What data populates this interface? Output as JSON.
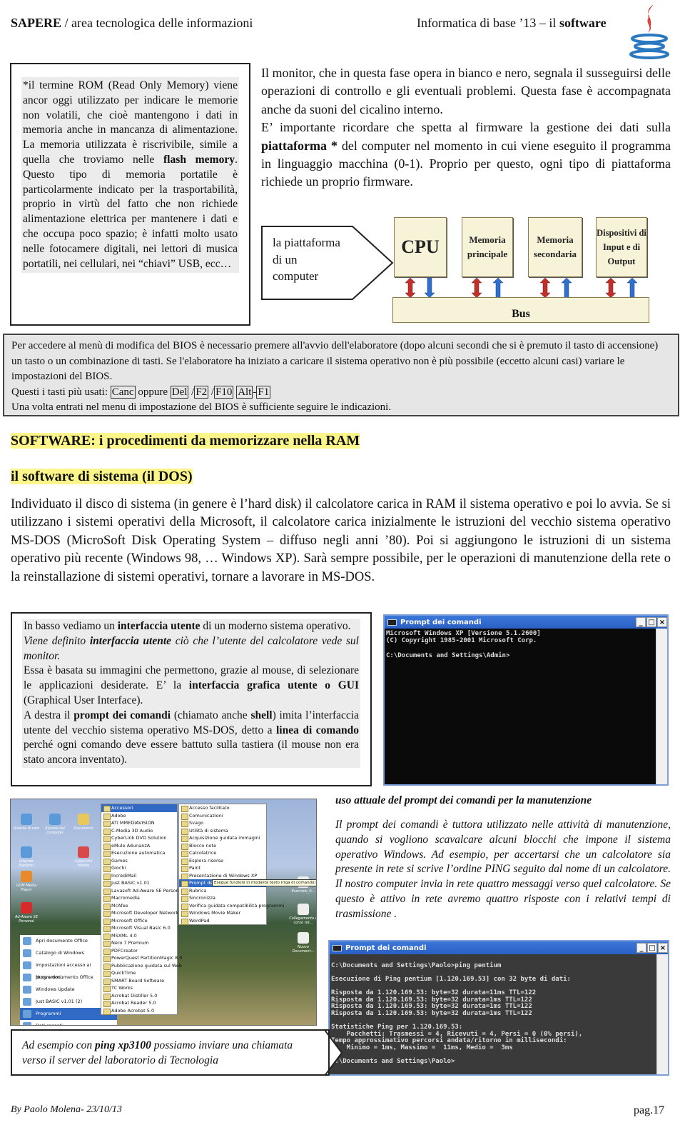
{
  "header": {
    "left_bold": "SAPERE",
    "left_rest": " / area tecnologica delle informazioni",
    "right_rest": "Informatica di base ’13 – il ",
    "right_bold": "software",
    "logo": "java-coffee-cup-logo"
  },
  "rom_box": {
    "p1": "*il termine ROM (Read Only Memory) viene ancor oggi utilizzato per indicare le memorie non volatili, che cioè mantengono i dati in memoria anche in mancanza di alimentazione. La memoria utilizzata è riscrivibile, simile a quella che troviamo nelle ",
    "p1_bold": "flash memory",
    "p2": ". Questo tipo di memoria portatile è particolarmente indicato per la trasportabilità, proprio in virtù del fatto che non richiede alimentazione elettrica per mantenere i dati e che occupa poco spazio; è infatti molto usato nelle fotocamere digitali, nei lettori di musica portatili, nei cellulari, nei “chiavi” USB, ecc…"
  },
  "right_text": {
    "p1": "Il monitor, che in questa fase opera in bianco e nero, segnala il susseguirsi delle operazioni di controllo e gli eventuali problemi. Questa fase è accompagnata anche da suoni del cicalino interno.",
    "p2a": "E’ importante ricordare che spetta al firmware la gestione dei dati sulla ",
    "p2b": "piattaforma *",
    "p2c": " del computer nel momento in cui viene eseguito il programma in linguaggio macchina (0-1). Proprio per questo, ogni tipo di piattaforma richiede un proprio firmware."
  },
  "callout": {
    "line1": "la piattaforma",
    "line2": "di un",
    "line3": "computer"
  },
  "diagram": {
    "modules": [
      "CPU",
      "Memoria principale",
      "Memoria secondaria",
      "Dispositivi di Input e di Output"
    ],
    "bus": "Bus",
    "colors": {
      "box": "#f7f3d8",
      "arrow_bidir": "#c0302a",
      "arrow_up": "#2f6fd0"
    }
  },
  "bios": {
    "line1": "Per accedere al menù di modifica del BIOS è necessario premere all'avvio dell'elaboratore (dopo alcuni secondi che si è premuto il tasto di accensione) un tasto o un combinazione di tasti. Se l'elaboratore ha iniziato a caricare il sistema operativo non è più possibile (eccetto alcuni casi) variare le impostazioni del BIOS.",
    "keys_intro": "Questi i tasti più usati: ",
    "keys": [
      "Canc",
      "Del",
      "F2",
      "F10",
      "Alt",
      "F1"
    ],
    "oppure": " oppure ",
    "last": "Una volta entrati nel menu di impostazione del BIOS è sufficiente seguire le indicazioni."
  },
  "software_title": "SOFTWARE: i procedimenti da memorizzare nella RAM",
  "dos_title": "il software di sistema (il DOS)",
  "dos_para": "Individuato il disco di sistema (in genere è l’hard disk) il calcolatore carica in RAM il sistema operativo e poi lo avvia. Se si utilizzano i sistemi operativi della Microsoft, il calcolatore carica inizialmente le istruzioni del vecchio sistema operativo MS-DOS (MicroSoft Disk Operating System – diffuso negli anni ’80). Poi si aggiungono le istruzioni di un sistema operativo più recente (Windows 98, … Windows XP). Sarà sempre possibile, per le operazioni di manutenzione della rete o la reinstallazione di sistemi operativi,  tornare a lavorare in MS-DOS.",
  "gui_box": {
    "a1": "In basso vediamo un ",
    "a2": "interfaccia utente",
    "a3": " di un moderno sistema operativo.",
    "b1": "Viene definito ",
    "b2": "interfaccia utente",
    "b3": " ciò che l’utente del calcolatore vede sul monitor.",
    "c1": "Essa è basata su immagini che permettono, grazie al mouse, di selezionare le applicazioni desiderate. E’ la ",
    "c2": "interfaccia grafica utente o GUI",
    "c3": " (Graphical User Interface).",
    "d1": "A destra il ",
    "d2": "prompt dei comandi",
    "d3": " (chiamato anche ",
    "d4": "shell",
    "d5": ") imita l’interfaccia utente del vecchio sistema operativo MS-DOS, detto a ",
    "d6": "linea di comando",
    "d7": " perché ogni comando deve essere battuto sulla tastiera (il mouse non era stato ancora inventato)."
  },
  "cmd1": {
    "title": "Prompt dei comandi",
    "body": "Microsoft Windows XP [Versione 5.1.2600]\n(C) Copyright 1985-2001 Microsoft Corp.\n\nC:\\Documents and Settings\\Admin>"
  },
  "cmd2": {
    "title": "Prompt dei comandi",
    "body": "\nC:\\Documents and Settings\\Paolo>ping pentium\n\nEsecuzione di Ping pentium [1.120.169.53] con 32 byte di dati:\n\nRisposta da 1.120.169.53: byte=32 durata=11ms TTL=122\nRisposta da 1.120.169.53: byte=32 durata=1ms TTL=122\nRisposta da 1.120.169.53: byte=32 durata=1ms TTL=122\nRisposta da 1.120.169.53: byte=32 durata=1ms TTL=122\n\nStatistiche Ping per 1.120.169.53:\n    Pacchetti: Trasmessi = 4, Ricevuti = 4, Persi = 0 (0% persi),\nTempo approssimativo percorsi andata/ritorno in millisecondi:\n    Minimo = 1ms, Massimo =  11ms, Medio =  3ms\n\nC:\\Documents and Settings\\Paolo>"
  },
  "desktop": {
    "icons": [
      "Risorse di rete",
      "Risorse del computer",
      "Documenti",
      "Internet Explorer",
      "CyberLink Mobile",
      "GOM Media Player",
      "Ad-Aware SE Personal",
      "Esercizio_0...",
      "Collegamento a corso ret...",
      "Nuovo Document..."
    ],
    "programs": [
      "Accessori",
      "Adobe",
      "ATI MMEDIAVISION",
      "C-Media 3D Audio",
      "CyberLink DVD Solution",
      "eMule AdunanzA",
      "Esecuzione automatica",
      "Games",
      "Giochi",
      "IncrediMail",
      "Just BASIC v1.01",
      "Lavasoft Ad-Aware SE Personal",
      "Macromedia",
      "McAfee",
      "Microsoft Developer Network",
      "Microsoft Office",
      "Microsoft Visual Basic 6.0",
      "MSXML 4.0",
      "Nero 7 Premium",
      "PDFCreator",
      "PowerQuest PartitionMagic 8.0",
      "Pubblicazione guidata sul Web",
      "QuickTime",
      "SMART Board Software",
      "TC Works",
      "Acrobat Distiller 5.0",
      "Acrobat Reader 5.0",
      "Adobe Acrobat 5.0"
    ],
    "accessori": [
      "Accesso facilitato",
      "Comunicazioni",
      "Svago",
      "Utilità di sistema",
      "Acquisizione guidata immagini",
      "Blocco note",
      "Calcolatrice",
      "Esplora risorse",
      "Paint",
      "Presentazione di Windows XP",
      "Prompt dei comandi",
      "Rubrica",
      "Sincronizza",
      "Verifica guidata compatibilità programmi",
      "Windows Movie Maker",
      "WordPad"
    ],
    "tooltip": "Esegue funzioni in modalità testo (riga di comando)",
    "start_left": [
      "Apri documento Office",
      "Catalogo di Windows",
      "Impostazioni accesso ai programmi",
      "Nuovo documento Office",
      "Windows Update",
      "Just BASIC v1.01 (2)",
      "Programmi",
      "Dati recenti"
    ]
  },
  "right_section": {
    "title": "uso attuale del prompt dei comandi per la manutenzione",
    "body": "Il prompt dei comandi è tuttora utilizzato nelle attività di manutenzione, quando si vogliono scavalcare alcuni blocchi che impone il sistema operativo Windows. Ad esempio, per accertarsi che un calcolatore sia presente in rete si scrive l’ordine PING seguito dal nome di un calcolatore. Il nostro computer invia in rete quattro messaggi verso quel calcolatore. Se questo è attivo in rete avremo quattro risposte con i relativi tempi di trasmissione ."
  },
  "ping_box": {
    "a": "Ad esempio con ",
    "b": "ping xp3100",
    "c": " possiamo inviare una chiamata verso il server del laboratorio di Tecnologia"
  },
  "footer": {
    "author": "By Paolo Molena- 23/10/13",
    "page": "pag.17"
  }
}
